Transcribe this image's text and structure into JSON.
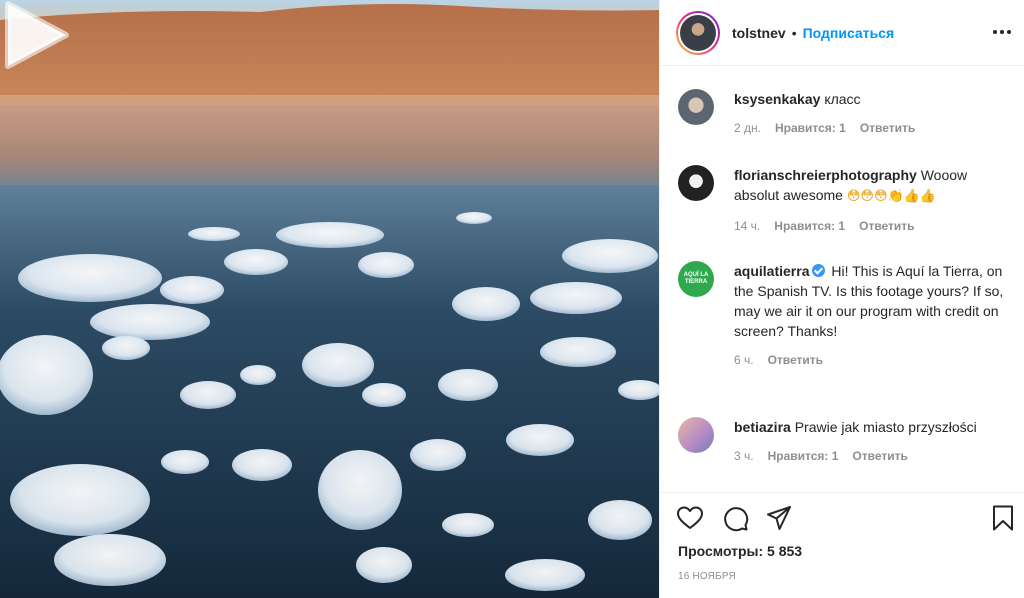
{
  "post": {
    "author": "tolstnev",
    "separator": "•",
    "follow_label": "Подписаться",
    "more_icon": "more-dots-icon"
  },
  "comments": [
    {
      "user": "ksysenkakay",
      "text": "класс",
      "time": "2 дн.",
      "likes": "Нравится: 1",
      "reply": "Ответить",
      "avatar_color": "#8a8f94"
    },
    {
      "user": "florianschreierphotography",
      "text": "Wooow absolut awesome",
      "emojis": "😳😳😳👏👍👍",
      "time": "14 ч.",
      "likes": "Нравится: 1",
      "reply": "Ответить",
      "avatar_color": "#2a2a2a"
    },
    {
      "user": "aquilatierra",
      "verified": true,
      "text": "Hi! This is Aquí la Tierra, on the Spanish TV. Is this footage yours? If so, may we air it on our program with credit on screen? Thanks!",
      "time": "6 ч.",
      "reply": "Ответить",
      "avatar_text": "AQUÍ LA TIERRA",
      "avatar_color": "#2fa84f"
    },
    {
      "user": "betiazira",
      "text": "Prawie jak miasto przyszłości",
      "time": "3 ч.",
      "likes": "Нравится: 1",
      "reply": "Ответить",
      "avatar_color": "#c8b2c8"
    }
  ],
  "actions": {
    "views_label": "Просмотры: 5 853",
    "date": "16 ноября",
    "icons": [
      "heart-icon",
      "comment-icon",
      "share-icon",
      "bookmark-icon"
    ]
  },
  "colors": {
    "accent": "#0095f6",
    "text": "#262626",
    "secondary": "#8e8e8e",
    "border": "#efefef"
  }
}
